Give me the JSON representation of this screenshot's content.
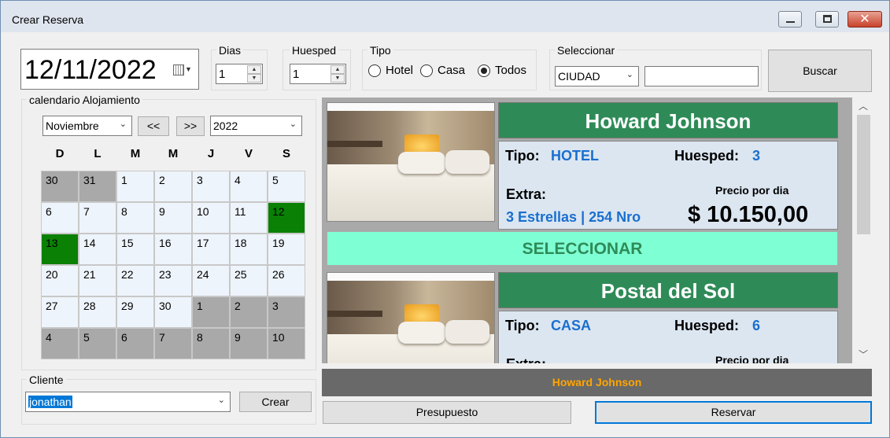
{
  "window": {
    "title": "Crear Reserva"
  },
  "date": {
    "value": "12/11/2022"
  },
  "dias": {
    "label": "Dias",
    "value": "1"
  },
  "huesped": {
    "label": "Huesped",
    "value": "1"
  },
  "tipo": {
    "label": "Tipo",
    "options": [
      "Hotel",
      "Casa",
      "Todos"
    ],
    "selected": "Todos"
  },
  "seleccionar": {
    "label": "Seleccionar",
    "filter": "CIUDAD",
    "text": ""
  },
  "buscar_label": "Buscar",
  "calendar": {
    "label": "calendario Alojamiento",
    "month": "Noviembre",
    "prev": "<<",
    "next": ">>",
    "year": "2022",
    "weekdays": [
      "D",
      "L",
      "M",
      "M",
      "J",
      "V",
      "S"
    ],
    "weeks": [
      [
        "30",
        "31",
        "1",
        "2",
        "3",
        "4",
        "5"
      ],
      [
        "6",
        "7",
        "8",
        "9",
        "10",
        "11",
        "12"
      ],
      [
        "13",
        "14",
        "15",
        "16",
        "17",
        "18",
        "19"
      ],
      [
        "20",
        "21",
        "22",
        "23",
        "24",
        "25",
        "26"
      ],
      [
        "27",
        "28",
        "29",
        "30",
        "1",
        "2",
        "3"
      ],
      [
        "4",
        "5",
        "6",
        "7",
        "8",
        "9",
        "10"
      ]
    ],
    "colors": {
      "outside": "#a9a9a9",
      "selected": "#0a8005",
      "normal": "#eef4fb"
    }
  },
  "cliente": {
    "label": "Cliente",
    "value": "jonathan",
    "crear_label": "Crear"
  },
  "listings": [
    {
      "name": "Howard Johnson",
      "tipo_label": "Tipo:",
      "tipo": "HOTEL",
      "huesped_label": "Huesped:",
      "huesped": "3",
      "extra_label": "Extra:",
      "extra": "3 Estrellas | 254 Nro",
      "precio_label": "Precio por dia",
      "precio": "$ 10.150,00",
      "select_label": "SELECCIONAR"
    },
    {
      "name": "Postal del Sol",
      "tipo_label": "Tipo:",
      "tipo": "CASA",
      "huesped_label": "Huesped:",
      "huesped": "6",
      "extra_label": "Extra:",
      "precio_label": "Precio por dia"
    }
  ],
  "selected_bar": "Howard Johnson",
  "presupuesto_label": "Presupuesto",
  "reservar_label": "Reservar",
  "colors": {
    "header_green": "#2e8b57",
    "select_aqua": "#7fffd4",
    "value_blue": "#1a6fce",
    "selected_text": "#ffa500"
  }
}
